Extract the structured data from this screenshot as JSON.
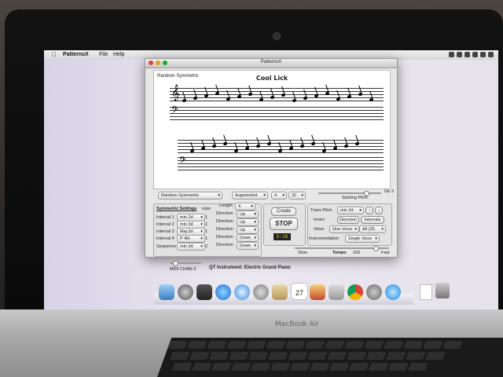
{
  "menubar": {
    "app_name": "PatternsX",
    "items": [
      "File",
      "Help"
    ]
  },
  "window": {
    "title": "PatternsX"
  },
  "score": {
    "pattern_label": "Random Symmetric",
    "title": "Cool Lick"
  },
  "top_controls": {
    "pattern_select": "Random Symmetric",
    "scale_select": "Augmented",
    "count_a": "4",
    "count_b": "32",
    "starting_pitch_label": "Starting Pitch",
    "starting_pitch_value": "Gb 3"
  },
  "symmetric": {
    "heading": "Symmetric Settings",
    "reps_label": "reps",
    "length_label": "Length",
    "length_value": "4",
    "intervals": [
      {
        "label": "Interval 1",
        "value": "min 2d",
        "reps": "1"
      },
      {
        "label": "Interval 2",
        "value": "min 3d",
        "reps": "1"
      },
      {
        "label": "Interval 3",
        "value": "Maj 3d",
        "reps": "1"
      },
      {
        "label": "Interval 4",
        "value": "P 4th",
        "reps": "1"
      }
    ],
    "sequence_label": "Sequence",
    "sequence_value": "min 3d",
    "sequence_reps": "2",
    "directions": [
      {
        "label": "Direction",
        "value": "Up"
      },
      {
        "label": "Direction",
        "value": "Up"
      },
      {
        "label": "Direction",
        "value": "Up"
      },
      {
        "label": "Direction",
        "value": "Down"
      },
      {
        "label": "Direction",
        "value": "Down"
      }
    ]
  },
  "center": {
    "create_label": "Create",
    "stop_label": "STOP",
    "time": "5:16"
  },
  "right_panel": {
    "trans_pitch_label": "Trans Pitch",
    "trans_pitch_value": "min 2d",
    "invert_label": "Invert",
    "direction_button": "Direction",
    "intervals_button": "Intervals",
    "voice_label": "Voice",
    "voice_value": "One Voice",
    "voice_range": "All (2f)",
    "instrumentation_label": "Instrumentation",
    "instrumentation_value": "Single Voice"
  },
  "bottom": {
    "slow_label": "Slow",
    "tempo_label": "Tempo",
    "tempo_value": "160",
    "fast_label": "Fast",
    "midi_label": "MIDI CHAN 3",
    "qt_label": "QT Instrument: Electric Grand Piano"
  },
  "calendar_day": "27",
  "laptop_label": "MacBook Air"
}
